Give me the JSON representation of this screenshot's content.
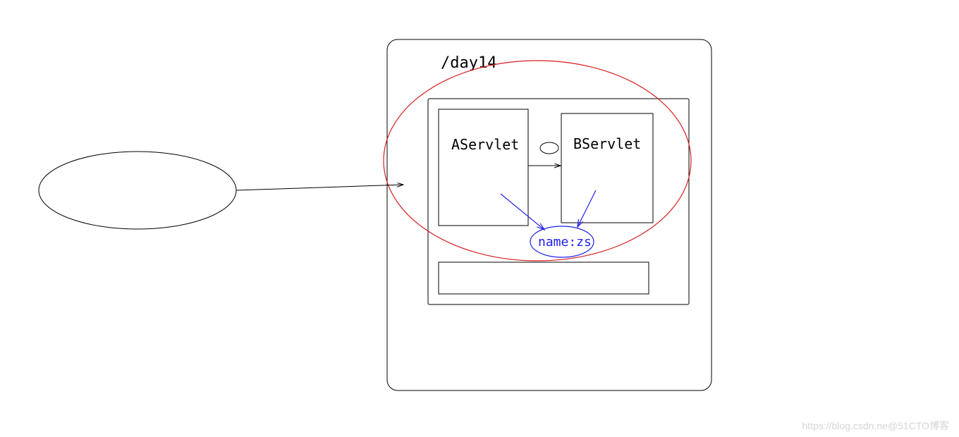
{
  "diagram": {
    "container_label": "/day14",
    "servlet_a_label": "AServlet",
    "servlet_b_label": "BServlet",
    "request_scope_label": "name:zs",
    "watermark": "https://blog.csdn.ne@51CTO博客"
  }
}
